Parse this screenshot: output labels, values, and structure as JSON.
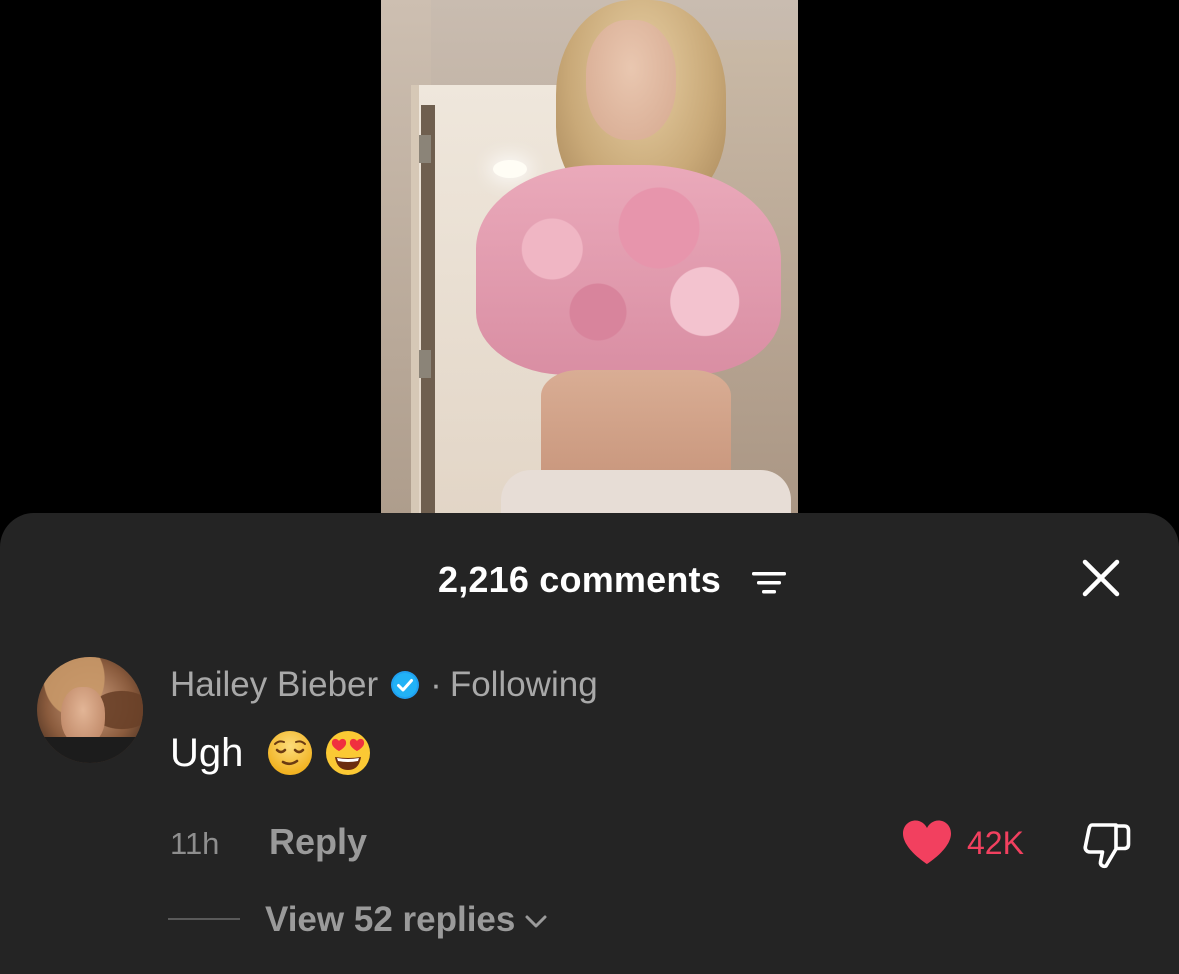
{
  "video": {
    "image_desc": ""
  },
  "comments_sheet": {
    "header": {
      "count_label": "2,216 comments",
      "filter_icon": "filter-icon",
      "close_icon": "close-icon"
    },
    "comment": {
      "username": "Hailey Bieber",
      "verified_icon": "verified-badge-icon",
      "separator": "·",
      "relationship": "Following",
      "text": "Ugh",
      "emojis": [
        "relieved-face-emoji",
        "heart-eyes-emoji"
      ],
      "time": "11h",
      "reply_label": "Reply",
      "like_count": "42K",
      "like_icon": "heart-icon",
      "dislike_icon": "thumbs-down-icon",
      "view_replies_label": "View 52 replies",
      "view_replies_icon": "chevron-down-icon"
    }
  },
  "colors": {
    "sheet_bg": "#242424",
    "like_red": "#f2405f",
    "verified_blue": "#20a0f0",
    "muted_text": "#a8a8a8"
  }
}
